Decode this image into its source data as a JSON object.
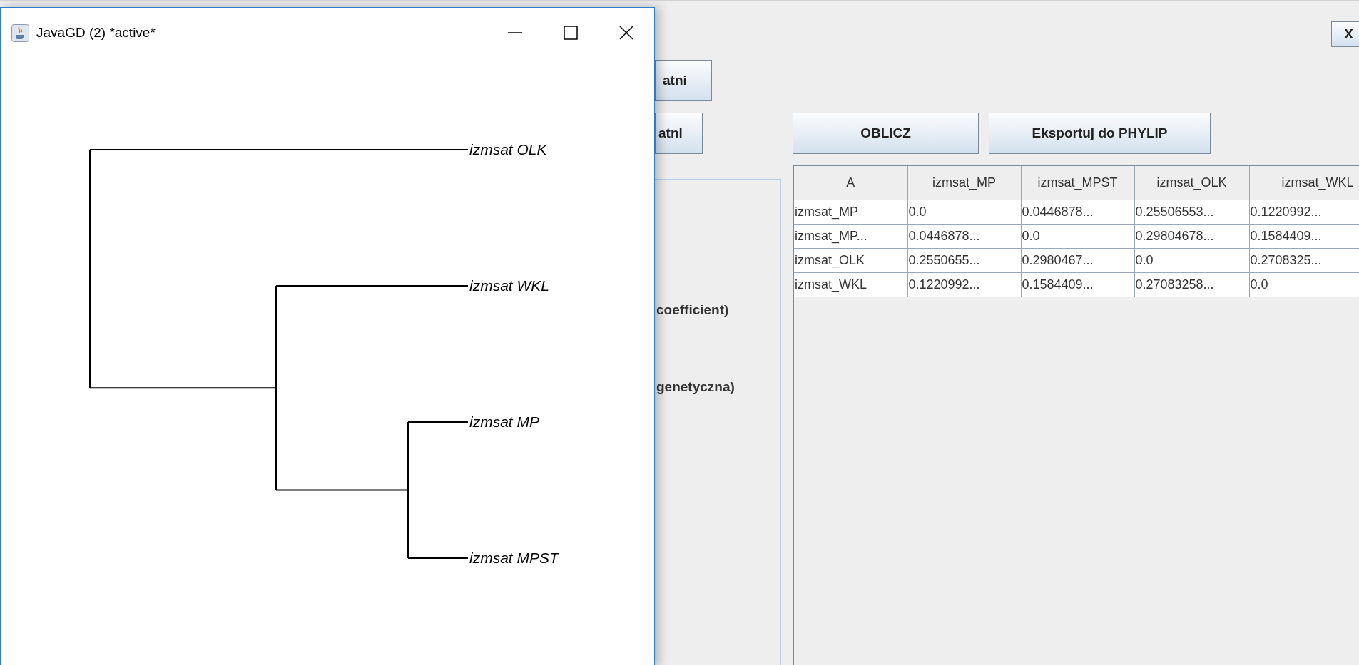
{
  "window": {
    "title": "JavaGD (2) *active*"
  },
  "dendrogram": {
    "children": [
      {
        "label": "izmsat OLK"
      },
      {
        "children": [
          {
            "label": "izmsat WKL"
          },
          {
            "children": [
              {
                "label": "izmsat MP"
              },
              {
                "label": "izmsat MPST"
              }
            ]
          }
        ]
      }
    ]
  },
  "app": {
    "close_button": "X",
    "side_buttons": [
      "atni",
      "atni"
    ],
    "actions": [
      "OBLICZ",
      "Eksportuj do PHYLIP"
    ],
    "options": [
      "coefficient)",
      "genetyczna)"
    ],
    "table": {
      "columns": [
        "A",
        "izmsat_MP",
        "izmsat_MPST",
        "izmsat_OLK",
        "izmsat_WKL"
      ],
      "rows": [
        [
          "izmsat_MP",
          "0.0",
          "0.0446878...",
          "0.25506553...",
          "0.1220992..."
        ],
        [
          "izmsat_MP...",
          "0.0446878...",
          "0.0",
          "0.29804678...",
          "0.1584409..."
        ],
        [
          "izmsat_OLK",
          "0.2550655...",
          "0.2980467...",
          "0.0",
          "0.2708325..."
        ],
        [
          "izmsat_WKL",
          "0.1220992...",
          "0.1584409...",
          "0.27083258...",
          "0.0"
        ]
      ]
    }
  }
}
